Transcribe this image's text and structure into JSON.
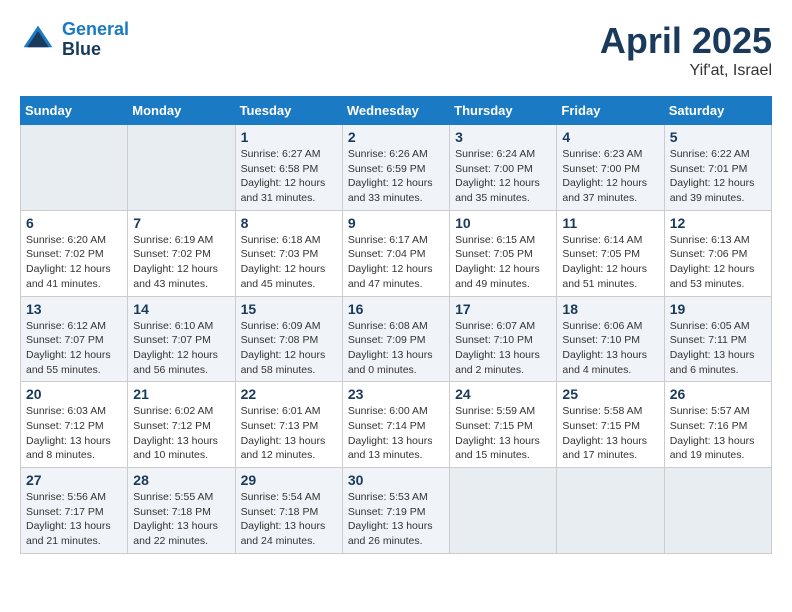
{
  "logo": {
    "line1": "General",
    "line2": "Blue"
  },
  "title": "April 2025",
  "subtitle": "Yif'at, Israel",
  "weekdays": [
    "Sunday",
    "Monday",
    "Tuesday",
    "Wednesday",
    "Thursday",
    "Friday",
    "Saturday"
  ],
  "weeks": [
    [
      {
        "day": "",
        "info": ""
      },
      {
        "day": "",
        "info": ""
      },
      {
        "day": "1",
        "info": "Sunrise: 6:27 AM\nSunset: 6:58 PM\nDaylight: 12 hours\nand 31 minutes."
      },
      {
        "day": "2",
        "info": "Sunrise: 6:26 AM\nSunset: 6:59 PM\nDaylight: 12 hours\nand 33 minutes."
      },
      {
        "day": "3",
        "info": "Sunrise: 6:24 AM\nSunset: 7:00 PM\nDaylight: 12 hours\nand 35 minutes."
      },
      {
        "day": "4",
        "info": "Sunrise: 6:23 AM\nSunset: 7:00 PM\nDaylight: 12 hours\nand 37 minutes."
      },
      {
        "day": "5",
        "info": "Sunrise: 6:22 AM\nSunset: 7:01 PM\nDaylight: 12 hours\nand 39 minutes."
      }
    ],
    [
      {
        "day": "6",
        "info": "Sunrise: 6:20 AM\nSunset: 7:02 PM\nDaylight: 12 hours\nand 41 minutes."
      },
      {
        "day": "7",
        "info": "Sunrise: 6:19 AM\nSunset: 7:02 PM\nDaylight: 12 hours\nand 43 minutes."
      },
      {
        "day": "8",
        "info": "Sunrise: 6:18 AM\nSunset: 7:03 PM\nDaylight: 12 hours\nand 45 minutes."
      },
      {
        "day": "9",
        "info": "Sunrise: 6:17 AM\nSunset: 7:04 PM\nDaylight: 12 hours\nand 47 minutes."
      },
      {
        "day": "10",
        "info": "Sunrise: 6:15 AM\nSunset: 7:05 PM\nDaylight: 12 hours\nand 49 minutes."
      },
      {
        "day": "11",
        "info": "Sunrise: 6:14 AM\nSunset: 7:05 PM\nDaylight: 12 hours\nand 51 minutes."
      },
      {
        "day": "12",
        "info": "Sunrise: 6:13 AM\nSunset: 7:06 PM\nDaylight: 12 hours\nand 53 minutes."
      }
    ],
    [
      {
        "day": "13",
        "info": "Sunrise: 6:12 AM\nSunset: 7:07 PM\nDaylight: 12 hours\nand 55 minutes."
      },
      {
        "day": "14",
        "info": "Sunrise: 6:10 AM\nSunset: 7:07 PM\nDaylight: 12 hours\nand 56 minutes."
      },
      {
        "day": "15",
        "info": "Sunrise: 6:09 AM\nSunset: 7:08 PM\nDaylight: 12 hours\nand 58 minutes."
      },
      {
        "day": "16",
        "info": "Sunrise: 6:08 AM\nSunset: 7:09 PM\nDaylight: 13 hours\nand 0 minutes."
      },
      {
        "day": "17",
        "info": "Sunrise: 6:07 AM\nSunset: 7:10 PM\nDaylight: 13 hours\nand 2 minutes."
      },
      {
        "day": "18",
        "info": "Sunrise: 6:06 AM\nSunset: 7:10 PM\nDaylight: 13 hours\nand 4 minutes."
      },
      {
        "day": "19",
        "info": "Sunrise: 6:05 AM\nSunset: 7:11 PM\nDaylight: 13 hours\nand 6 minutes."
      }
    ],
    [
      {
        "day": "20",
        "info": "Sunrise: 6:03 AM\nSunset: 7:12 PM\nDaylight: 13 hours\nand 8 minutes."
      },
      {
        "day": "21",
        "info": "Sunrise: 6:02 AM\nSunset: 7:12 PM\nDaylight: 13 hours\nand 10 minutes."
      },
      {
        "day": "22",
        "info": "Sunrise: 6:01 AM\nSunset: 7:13 PM\nDaylight: 13 hours\nand 12 minutes."
      },
      {
        "day": "23",
        "info": "Sunrise: 6:00 AM\nSunset: 7:14 PM\nDaylight: 13 hours\nand 13 minutes."
      },
      {
        "day": "24",
        "info": "Sunrise: 5:59 AM\nSunset: 7:15 PM\nDaylight: 13 hours\nand 15 minutes."
      },
      {
        "day": "25",
        "info": "Sunrise: 5:58 AM\nSunset: 7:15 PM\nDaylight: 13 hours\nand 17 minutes."
      },
      {
        "day": "26",
        "info": "Sunrise: 5:57 AM\nSunset: 7:16 PM\nDaylight: 13 hours\nand 19 minutes."
      }
    ],
    [
      {
        "day": "27",
        "info": "Sunrise: 5:56 AM\nSunset: 7:17 PM\nDaylight: 13 hours\nand 21 minutes."
      },
      {
        "day": "28",
        "info": "Sunrise: 5:55 AM\nSunset: 7:18 PM\nDaylight: 13 hours\nand 22 minutes."
      },
      {
        "day": "29",
        "info": "Sunrise: 5:54 AM\nSunset: 7:18 PM\nDaylight: 13 hours\nand 24 minutes."
      },
      {
        "day": "30",
        "info": "Sunrise: 5:53 AM\nSunset: 7:19 PM\nDaylight: 13 hours\nand 26 minutes."
      },
      {
        "day": "",
        "info": ""
      },
      {
        "day": "",
        "info": ""
      },
      {
        "day": "",
        "info": ""
      }
    ]
  ]
}
